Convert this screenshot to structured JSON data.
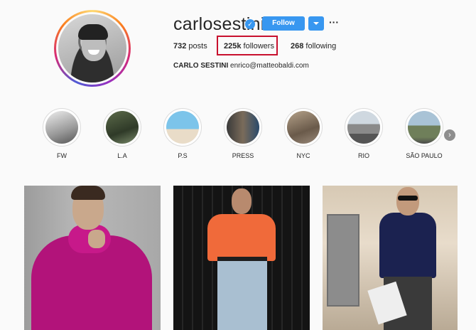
{
  "profile": {
    "username": "carlosestini",
    "verified_icon": "verified-badge-icon",
    "follow_label": "Follow",
    "more_label": "···",
    "posts_count": "732",
    "posts_label": "posts",
    "followers_count": "225k",
    "followers_label": "followers",
    "following_count": "268",
    "following_label": "following",
    "full_name": "CARLO SESTINI",
    "email": "enrico@matteobaldi.com"
  },
  "stories": [
    {
      "label": "FW"
    },
    {
      "label": "L.A"
    },
    {
      "label": "P.S"
    },
    {
      "label": "PRESS"
    },
    {
      "label": "NYC"
    },
    {
      "label": "RIO"
    },
    {
      "label": "SÃO PAULO"
    }
  ],
  "colors": {
    "accent": "#3897f0",
    "highlight_border": "#c8102e",
    "background": "#fafafa"
  }
}
